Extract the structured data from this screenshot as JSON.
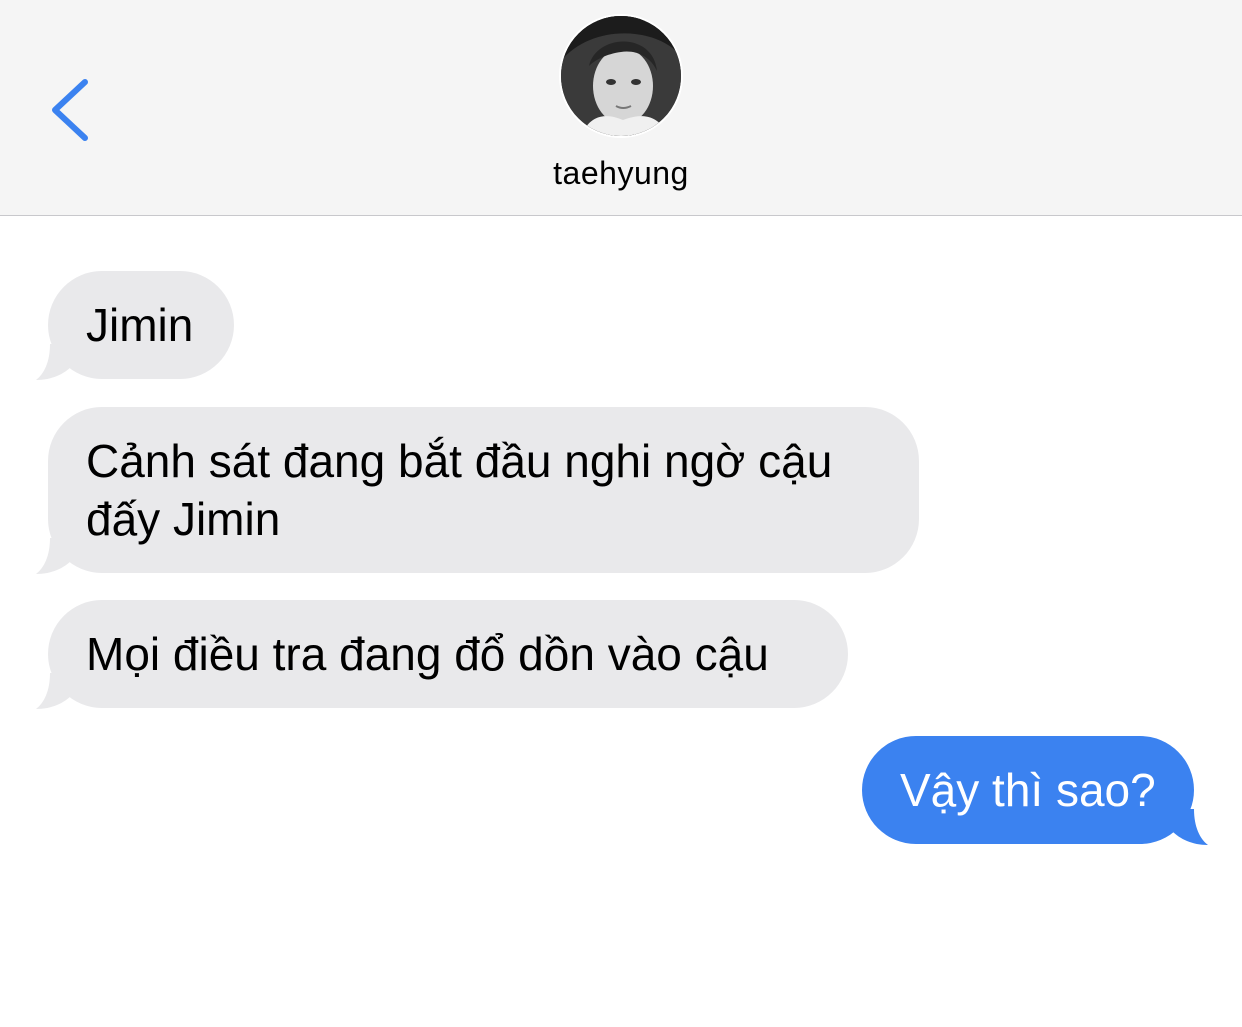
{
  "header": {
    "contact_name": "taehyung",
    "back_icon": "chevron-left-icon",
    "avatar_icon": "contact-avatar-photo"
  },
  "colors": {
    "accent": "#3b82f0",
    "received_bubble": "#e9e9eb",
    "header_bg": "#f5f5f5"
  },
  "messages": [
    {
      "direction": "received",
      "text": "Jimin"
    },
    {
      "direction": "received",
      "text": "Cảnh sát đang bắt đầu nghi ngờ cậu đấy Jimin"
    },
    {
      "direction": "received",
      "text": "Mọi điều tra đang đổ dồn vào cậu"
    },
    {
      "direction": "sent",
      "text": "Vậy thì sao?"
    }
  ]
}
